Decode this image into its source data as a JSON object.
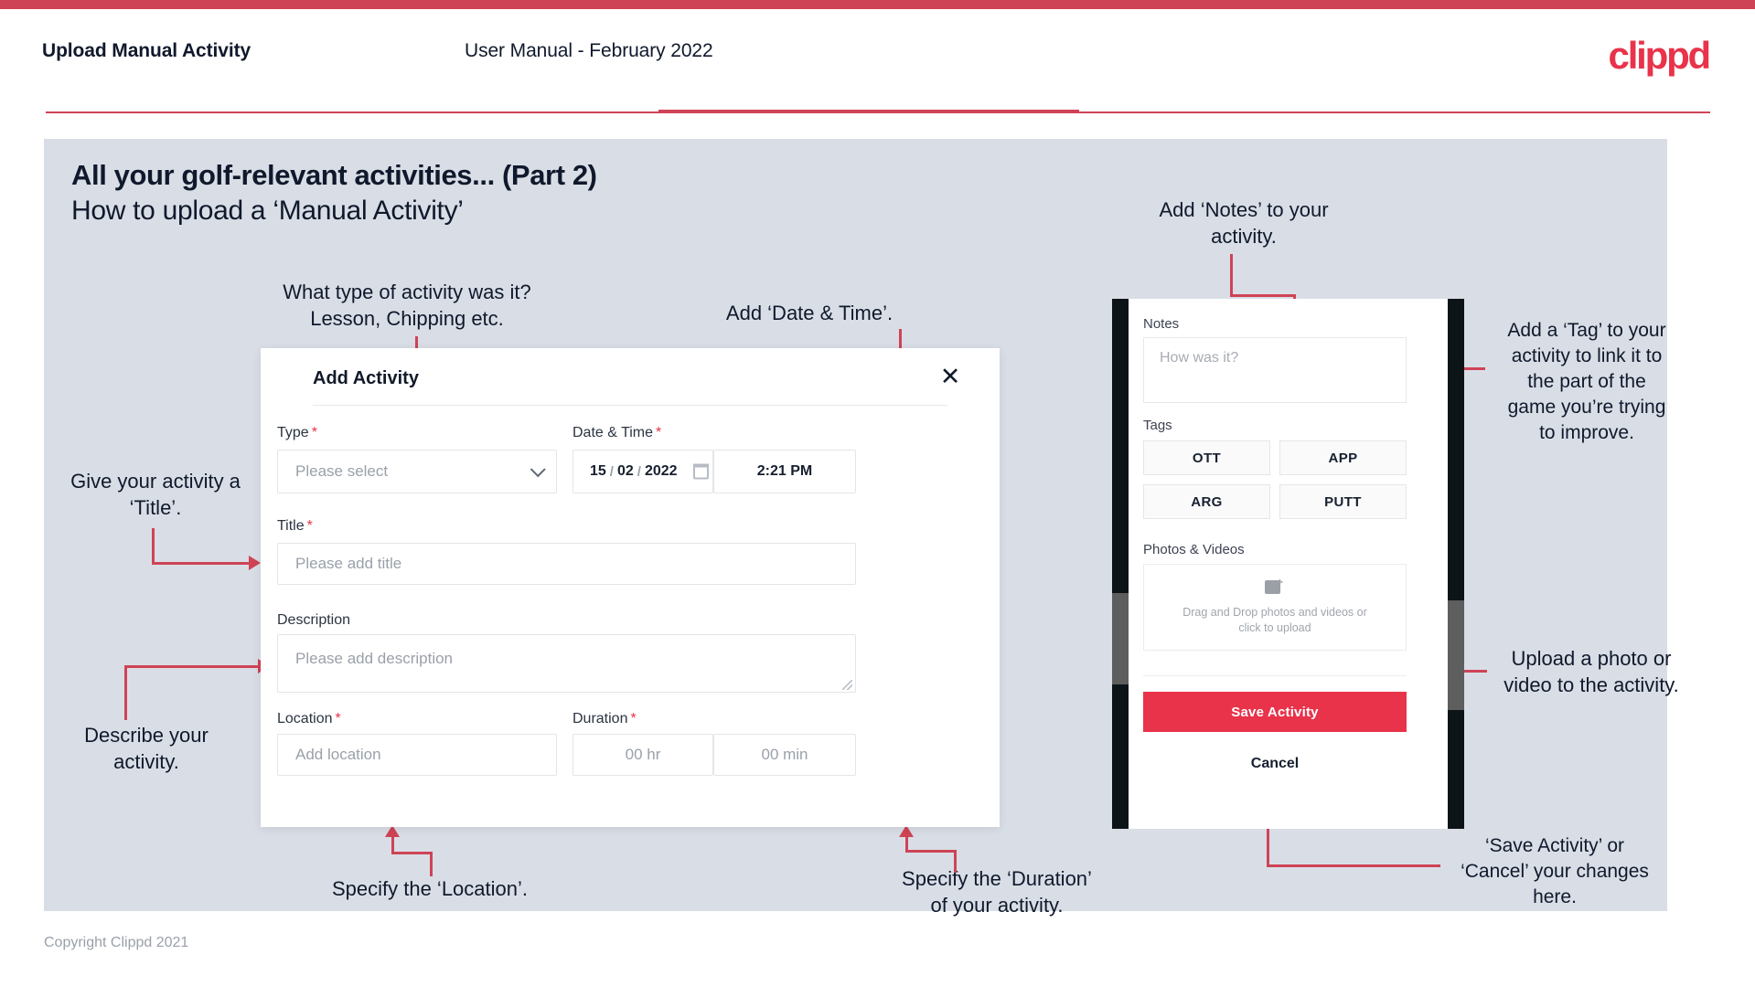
{
  "header": {
    "title": "Upload Manual Activity",
    "subtitle": "User Manual - February 2022",
    "logo": "clippd"
  },
  "slide": {
    "title": "All your golf-relevant activities... (Part 2)",
    "subtitle": "How to upload a ‘Manual Activity’",
    "copyright": "Copyright Clippd 2021"
  },
  "annotations": {
    "type": "What type of activity was it?\nLesson, Chipping etc.",
    "datetime": "Add ‘Date & Time’.",
    "title": "Give your activity a\n‘Title’.",
    "description": "Describe your\nactivity.",
    "location": "Specify the ‘Location’.",
    "duration": "Specify the ‘Duration’\nof your activity.",
    "notes": "Add ‘Notes’ to your\nactivity.",
    "tags": "Add a ‘Tag’ to your\nactivity to link it to\nthe part of the\ngame you’re trying\nto improve.",
    "photos": "Upload a photo or\nvideo to the activity.",
    "save": "‘Save Activity’ or\n‘Cancel’ your changes\nhere."
  },
  "dialog": {
    "title": "Add Activity",
    "close_icon": "close-icon",
    "fields": {
      "type": {
        "label": "Type",
        "required": "*",
        "placeholder": "Please select"
      },
      "datetime": {
        "label": "Date & Time",
        "required": "*",
        "day": "15",
        "sep1": "/",
        "month": "02",
        "sep2": "/",
        "year": "2022",
        "time": "2:21 PM"
      },
      "title": {
        "label": "Title",
        "required": "*",
        "placeholder": "Please add title"
      },
      "description": {
        "label": "Description",
        "required": "",
        "placeholder": "Please add description"
      },
      "location": {
        "label": "Location",
        "required": "*",
        "placeholder": "Add location"
      },
      "duration": {
        "label": "Duration",
        "required": "*",
        "hours": "00 hr",
        "minutes": "00 min"
      }
    }
  },
  "phone": {
    "notes": {
      "label": "Notes",
      "placeholder": "How was it?"
    },
    "tags": {
      "label": "Tags",
      "items": [
        "OTT",
        "APP",
        "ARG",
        "PUTT"
      ]
    },
    "photos": {
      "label": "Photos & Videos",
      "dropzone_line1": "Drag and Drop photos and videos or",
      "dropzone_line2": "click to upload",
      "icon": "add-image-icon"
    },
    "save_label": "Save Activity",
    "cancel_label": "Cancel"
  },
  "colors": {
    "brand_red": "#e8334a",
    "rule_red": "#cf4356",
    "slide_bg": "#d9dee6",
    "ink": "#10192c"
  }
}
